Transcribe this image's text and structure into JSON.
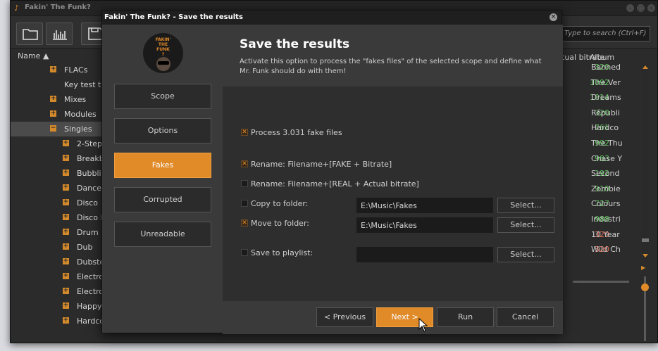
{
  "app": {
    "title": "Fakin' The Funk?",
    "icon": "guitar-icon"
  },
  "toolbar": {
    "buttons": [
      "folder-icon",
      "waveform-icon",
      "save-icon"
    ],
    "search_placeholder": "Type to search (Ctrl+F)"
  },
  "tree": {
    "header": "Name ▲",
    "items": [
      {
        "label": "FLACs",
        "expander": "+",
        "indent": 1
      },
      {
        "label": "Key test tr",
        "expander": "",
        "indent": 1
      },
      {
        "label": "Mixes",
        "expander": "+",
        "indent": 1
      },
      {
        "label": "Modules",
        "expander": "+",
        "indent": 1
      },
      {
        "label": "Singles",
        "expander": "−",
        "indent": 1,
        "selected": true
      },
      {
        "label": "2-Step",
        "expander": "+",
        "indent": 2
      },
      {
        "label": "Breakb",
        "expander": "+",
        "indent": 2
      },
      {
        "label": "Bubblin",
        "expander": "+",
        "indent": 2
      },
      {
        "label": "Dance",
        "expander": "+",
        "indent": 2
      },
      {
        "label": "Disco",
        "expander": "+",
        "indent": 2
      },
      {
        "label": "Disco I",
        "expander": "+",
        "indent": 2
      },
      {
        "label": "Drum",
        "expander": "+",
        "indent": 2
      },
      {
        "label": "Dub",
        "expander": "+",
        "indent": 2
      },
      {
        "label": "Dubste",
        "expander": "+",
        "indent": 2
      },
      {
        "label": "Electro",
        "expander": "+",
        "indent": 2
      },
      {
        "label": "Electro",
        "expander": "+",
        "indent": 2
      },
      {
        "label": "Happy",
        "expander": "+",
        "indent": 2
      },
      {
        "label": "Hardco",
        "expander": "+",
        "indent": 2
      }
    ]
  },
  "tracks": {
    "col_bitrate": "tual bitrate",
    "col_album": "Album",
    "rows": [
      {
        "bitrate": "320",
        "album": "Banned",
        "color": "green"
      },
      {
        "bitrate": "1092",
        "album": "The Ver",
        "color": "green"
      },
      {
        "bitrate": "1014",
        "album": "Dreams",
        "color": "green"
      },
      {
        "bitrate": "320",
        "album": "Républi",
        "color": "green"
      },
      {
        "bitrate": "761",
        "album": "Hardco",
        "color": "green"
      },
      {
        "bitrate": "992",
        "album": "The Thu",
        "color": "green"
      },
      {
        "bitrate": "983",
        "album": "Chase Y",
        "color": "green"
      },
      {
        "bitrate": "192",
        "album": "Second",
        "color": "green"
      },
      {
        "bitrate": "910",
        "album": "Zombie",
        "color": "green"
      },
      {
        "bitrate": "727",
        "album": "Colours",
        "color": "green"
      },
      {
        "bitrate": "988",
        "album": "Industri",
        "color": "green"
      },
      {
        "bitrate": "320",
        "album": "10 Year",
        "color": "red"
      },
      {
        "bitrate": "320",
        "album": "Wild Ch",
        "color": "red"
      }
    ]
  },
  "dialog": {
    "title": "Fakin' The Funk? - Save the results",
    "logo_text": "FAKIN' THE FUNK ?",
    "nav": [
      {
        "label": "Scope",
        "active": false
      },
      {
        "label": "Options",
        "active": false
      },
      {
        "label": "Fakes",
        "active": true
      },
      {
        "label": "Corrupted",
        "active": false
      },
      {
        "label": "Unreadable",
        "active": false
      }
    ],
    "heading": "Save the results",
    "description": "Activate this option to process the \"fakes files\" of the selected scope and define what Mr. Funk should do with them!",
    "options": {
      "process": {
        "label": "Process 3.031 fake files",
        "checked": true
      },
      "rename_fake": {
        "label": "Rename: Filename+[FAKE + Bitrate]",
        "checked": true
      },
      "rename_real": {
        "label": "Rename: Filename+[REAL + Actual bitrate]",
        "checked": false
      },
      "copy": {
        "label": "Copy to folder:",
        "checked": false,
        "path": "E:\\Music\\Fakes",
        "button": "Select..."
      },
      "move": {
        "label": "Move to folder:",
        "checked": true,
        "path": "E:\\Music\\Fakes",
        "button": "Select..."
      },
      "playlist": {
        "label": "Save to playlist:",
        "checked": false,
        "path": "",
        "button": "Select..."
      }
    },
    "footer": {
      "previous": "< Previous",
      "next": "Next >",
      "run": "Run",
      "cancel": "Cancel"
    }
  },
  "colors": {
    "accent": "#e08a28",
    "good_bitrate": "#5cc05c",
    "bad_bitrate": "#e06a55"
  }
}
